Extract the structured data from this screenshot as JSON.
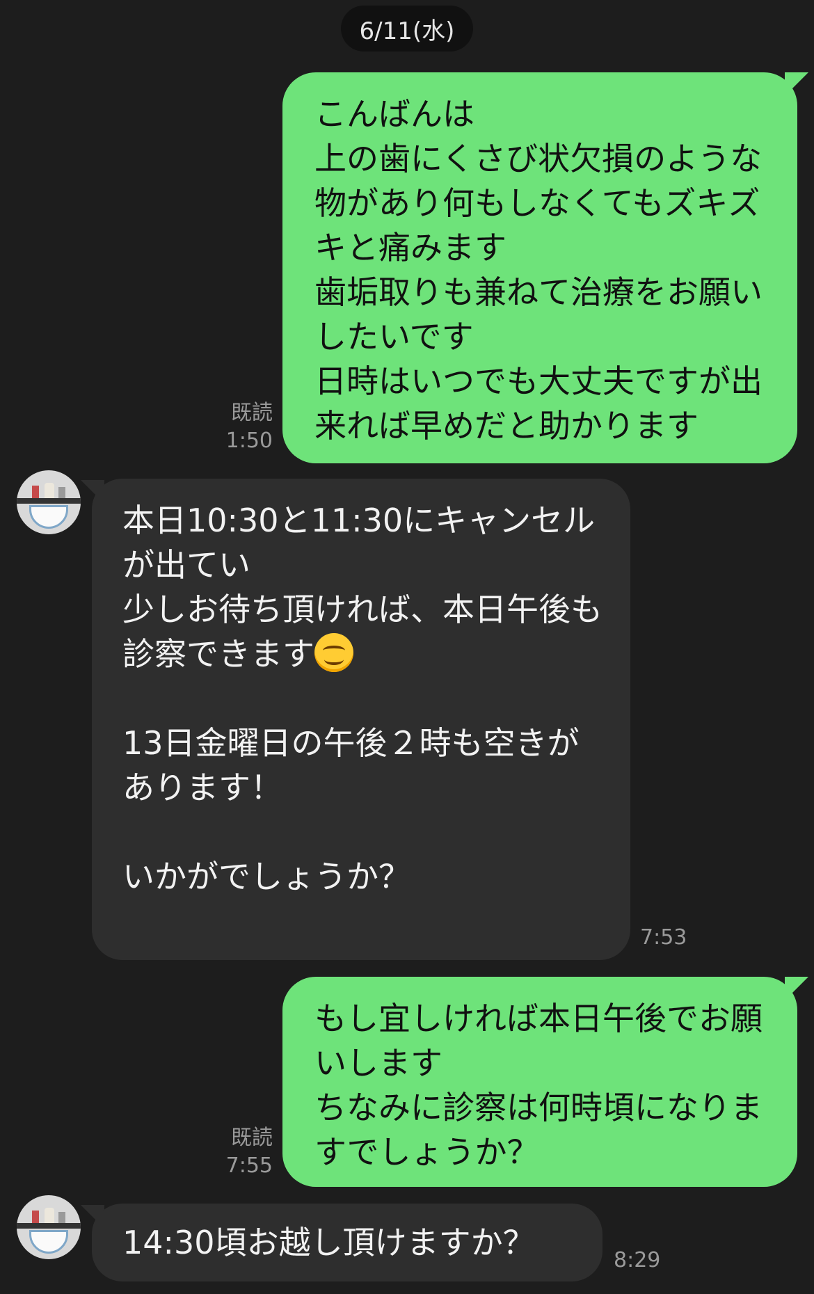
{
  "chat": {
    "date": "6/11(水)",
    "messages": [
      {
        "sender": "me",
        "text": "こんばんは\n上の歯にくさび状欠損のような物があり何もしなくてもズキズキと痛みます\n歯垢取りも兼ねて治療をお願いしたいです\n日時はいつでも大丈夫ですが出来れば早めだと助かります",
        "read_label": "既読",
        "time": "1:50"
      },
      {
        "sender": "them",
        "text_before_emoji": "本日10:30と11:30にキャンセルが出てい\n少しお待ち頂ければ、本日午後も診察できます",
        "emoji": "smiling-face-emoji",
        "text_after_emoji": "\n\n13日金曜日の午後２時も空きがあります！\n\nいかがでしょうか？\n",
        "time": "7:53"
      },
      {
        "sender": "me",
        "text": "もし宜しければ本日午後でお願いします\nちなみに診察は何時頃になりますでしょうか？",
        "read_label": "既読",
        "time": "7:55"
      },
      {
        "sender": "them",
        "text": "14:30頃お越し頂けますか？",
        "time": "8:29"
      }
    ]
  },
  "colors": {
    "background": "#1d1d1d",
    "outgoing_bubble": "#6ee37a",
    "incoming_bubble": "#2e2e2e",
    "meta_text": "#9a9a9a"
  }
}
